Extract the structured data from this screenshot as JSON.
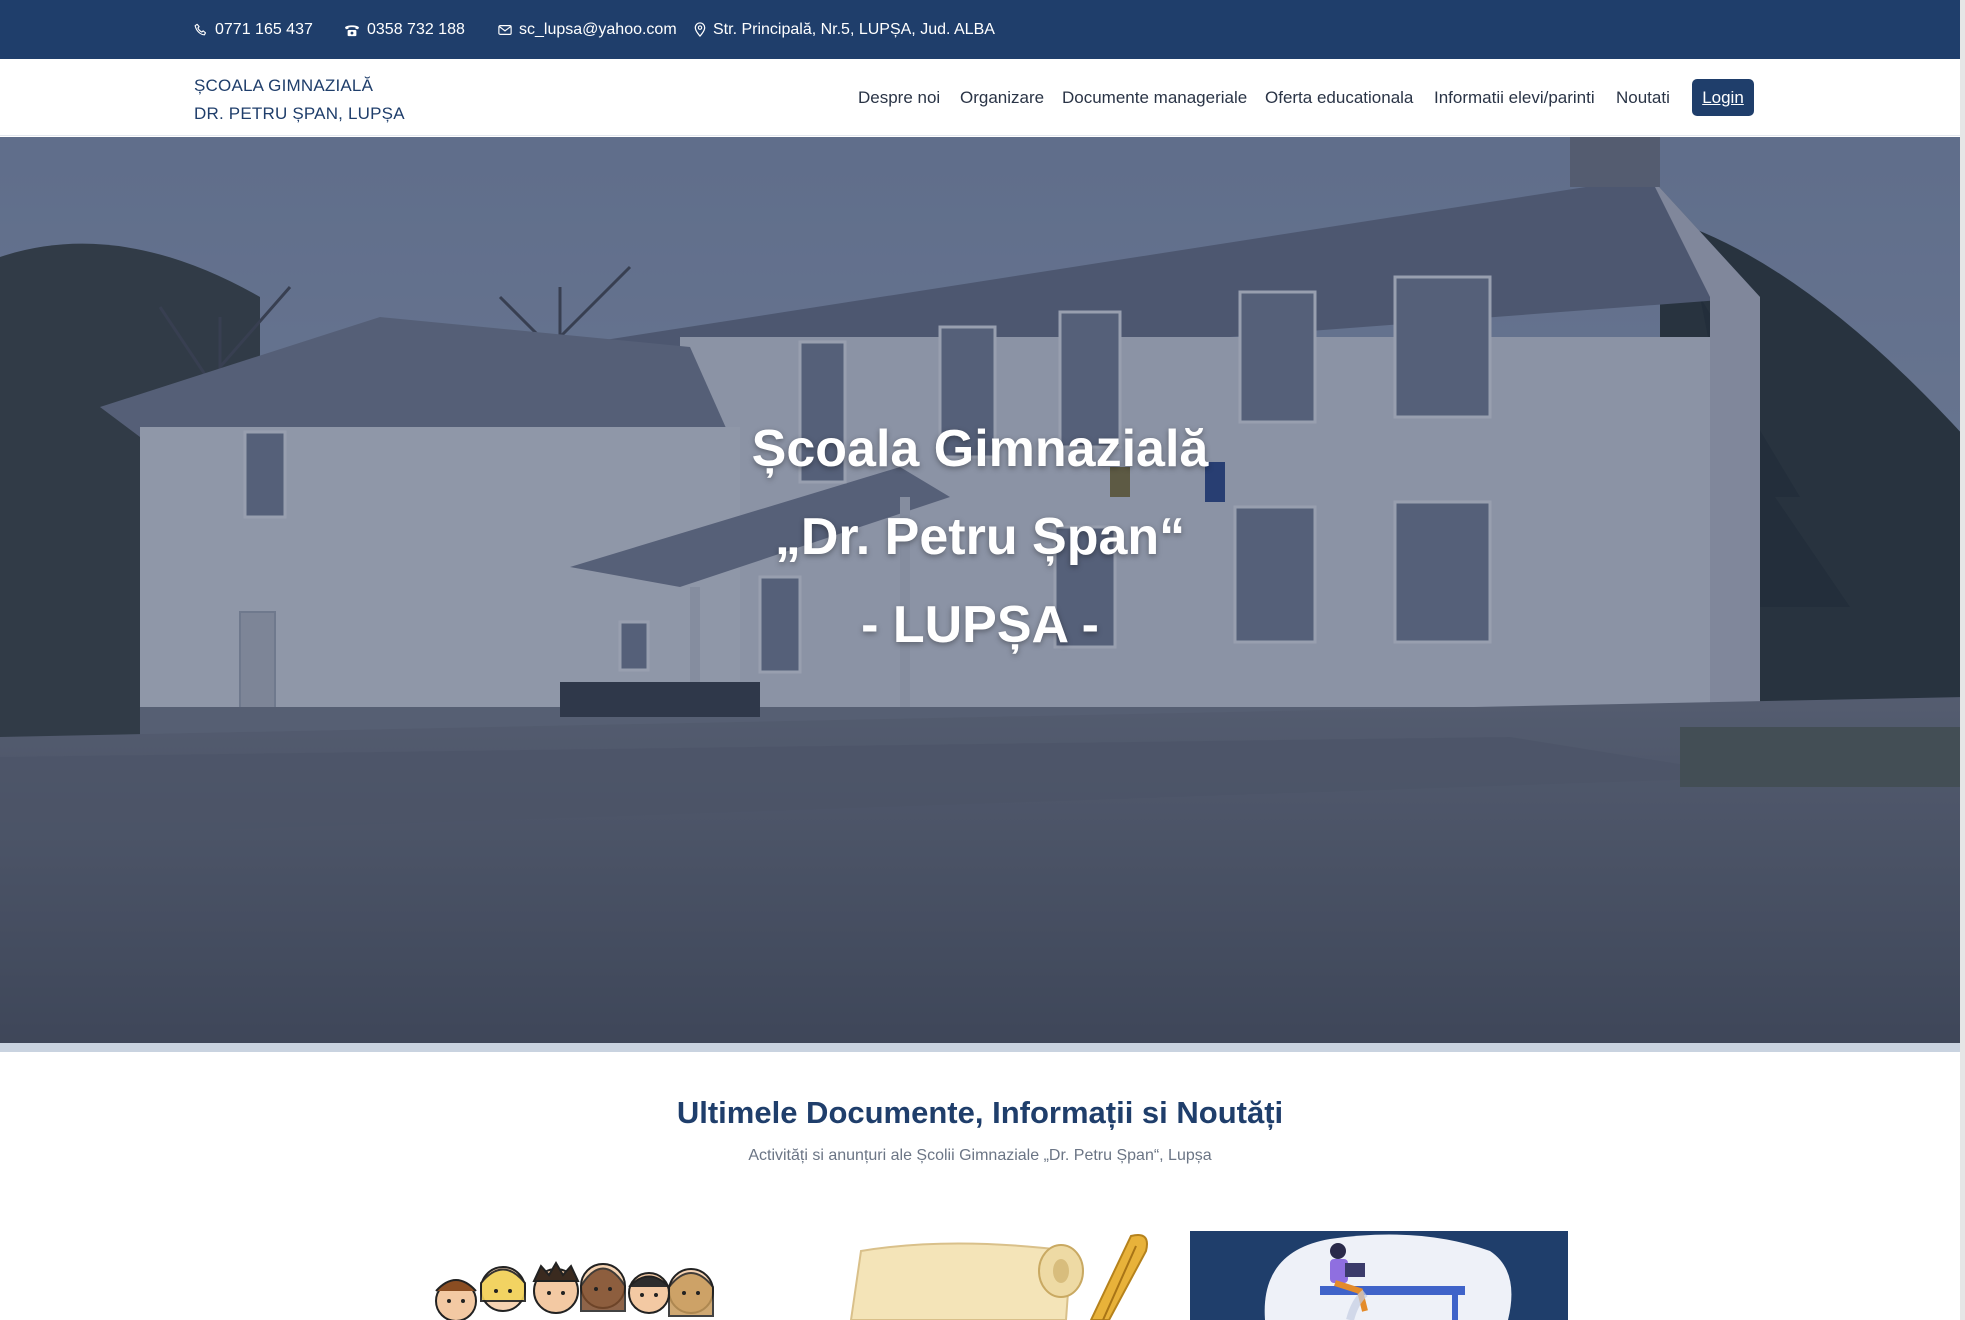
{
  "topbar": {
    "phone_mobile": "0771 165 437",
    "phone_fixed": "0358 732 188",
    "email": "sc_lupsa@yahoo.com",
    "address": "Str. Principală, Nr.5, LUPȘA, Jud. ALBA",
    "icons": [
      "phone-icon",
      "telephone-icon",
      "envelope-icon",
      "map-pin-icon"
    ]
  },
  "header": {
    "logo_line1": "ȘCOALA GIMNAZIALĂ",
    "logo_line2": "DR. PETRU ȘPAN, LUPȘA",
    "nav": [
      "Despre noi",
      "Organizare",
      "Documente manageriale",
      "Oferta educationala",
      "Informatii elevi/parinti",
      "Noutati"
    ],
    "login_label": "Login"
  },
  "hero": {
    "line1": "Școala Gimnazială",
    "line2": "„Dr. Petru Șpan“",
    "line3": "- LUPȘA -"
  },
  "section": {
    "title": "Ultimele Documente, Informații si Noutăți",
    "subtitle": "Activități si anunțuri ale Școlii Gimnaziale „Dr. Petru Șpan“, Lupșa"
  },
  "colors": {
    "primary": "#1f3e6b",
    "topbar": "#1f3e6b",
    "text": "#2a3446",
    "muted": "#6b7585"
  }
}
